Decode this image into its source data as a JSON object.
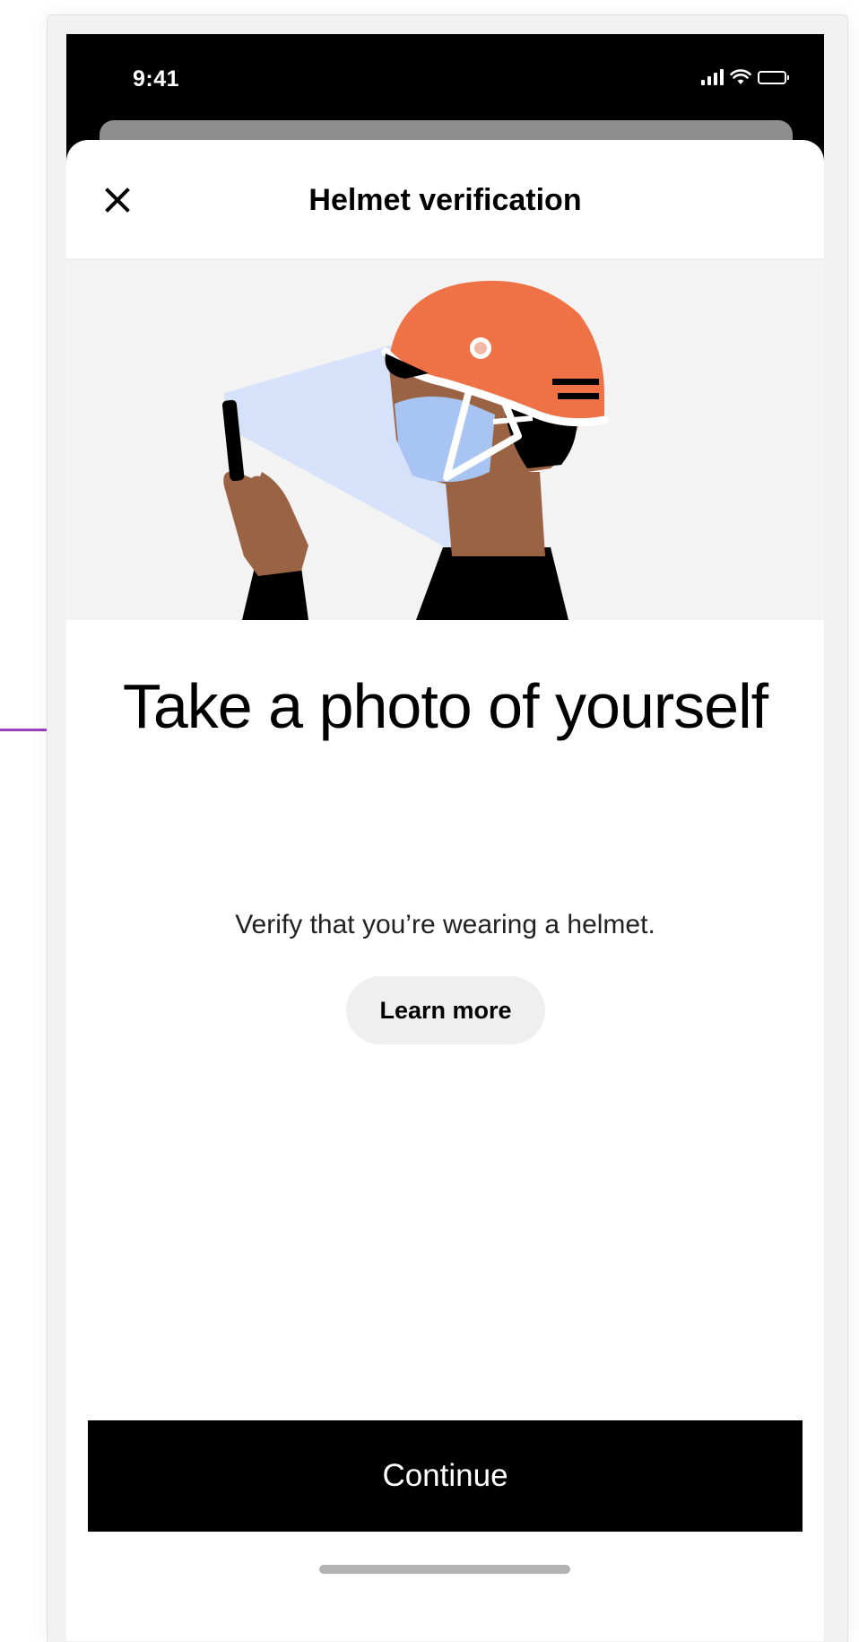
{
  "status_bar": {
    "time": "9:41",
    "icons": [
      "cellular-signal-icon",
      "wifi-icon",
      "battery-icon"
    ],
    "battery_level": 1.0
  },
  "header": {
    "close_icon": "close-icon",
    "title": "Helmet verification"
  },
  "illustration": {
    "subject": "person-with-helmet-taking-selfie",
    "colors": {
      "background": "#f3f3f3",
      "helmet": "#ef7247",
      "mask": "#a7c4f2",
      "camera_beam": "#d6e2fa",
      "skin": "#9a6444",
      "clothing": "#000000"
    }
  },
  "main": {
    "title": "Take a photo of yourself",
    "subtitle": "Verify that you’re wearing a helmet.",
    "learn_more_label": "Learn more"
  },
  "footer": {
    "continue_label": "Continue"
  },
  "colors": {
    "primary_button": "#000000",
    "secondary_button": "#efefef",
    "annotation_line": "#9b3fc0"
  }
}
